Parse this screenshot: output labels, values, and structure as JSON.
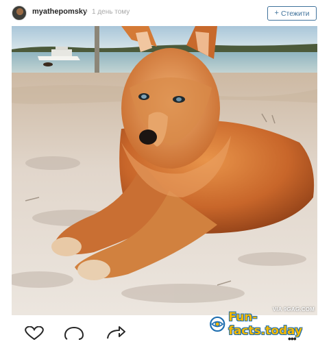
{
  "post": {
    "username": "myathepomsky",
    "separator": "•",
    "time": "1 день тому",
    "follow_label": "Стежити",
    "follow_plus": "+",
    "via": "VIA 9GAG.COM",
    "watermark": "Fun-facts.today",
    "more": "•••"
  },
  "icons": {
    "avatar": "user-avatar",
    "like": "heart-icon",
    "comment": "comment-bubble-icon",
    "share": "share-arrow-icon",
    "options": "more-options-icon",
    "watermark_logo": "eye-logo-icon"
  },
  "colors": {
    "follow_accent": "#3f729b",
    "watermark_fill": "#f5b800",
    "watermark_outline": "#1f6fb0"
  }
}
